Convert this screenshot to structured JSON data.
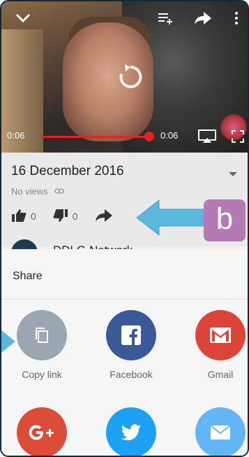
{
  "player": {
    "current_time": "0:06",
    "duration": "0:06"
  },
  "video_info": {
    "title": "16 December 2016",
    "views": "No views",
    "likes": "0",
    "dislikes": "0",
    "channel_name": "DDLG Network"
  },
  "annotation": {
    "badge_letter": "b"
  },
  "share": {
    "title": "Share",
    "targets": [
      {
        "label": "Copy link",
        "color": "#9aa6b2",
        "icon": "copy-icon"
      },
      {
        "label": "Facebook",
        "color": "#3b5998",
        "icon": "facebook-icon"
      },
      {
        "label": "Gmail",
        "color": "#db4437",
        "icon": "gmail-icon"
      },
      {
        "label": "",
        "color": "#dd4b39",
        "icon": "google-plus-icon"
      },
      {
        "label": "",
        "color": "#1da1f2",
        "icon": "twitter-icon"
      },
      {
        "label": "",
        "color": "#64b5f6",
        "icon": "email-icon"
      }
    ]
  }
}
